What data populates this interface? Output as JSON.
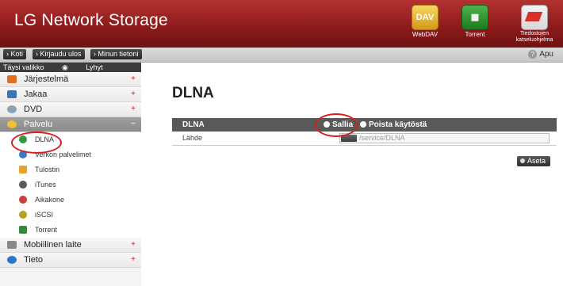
{
  "header": {
    "brand": "LG Network Storage",
    "icons": [
      {
        "name": "webdav-icon",
        "label": "WebDAV"
      },
      {
        "name": "torrent-icon",
        "label": "Torrent"
      },
      {
        "name": "manual-icon",
        "label": "Tiedostojen katseluohjelma"
      }
    ]
  },
  "toolbar": {
    "buttons": [
      "Koti",
      "Kirjaudu ulos",
      "Minun tietoni"
    ],
    "help": "Apu"
  },
  "sidebar": {
    "modes": [
      "Täysi valikko",
      "Lyhyt valikko"
    ],
    "categories": [
      {
        "label": "Järjestelmä",
        "icon": "system-icon",
        "color": "#e07020"
      },
      {
        "label": "Jakaa",
        "icon": "share-icon",
        "color": "#3f73b8"
      },
      {
        "label": "DVD",
        "icon": "dvd-icon",
        "color": "#8aa2b8"
      },
      {
        "label": "Palvelu",
        "icon": "service-icon",
        "color": "#f0c030",
        "active": true
      },
      {
        "label": "Mobiilinen laite",
        "icon": "mobile-icon",
        "color": "#8a8a8a"
      },
      {
        "label": "Tieto",
        "icon": "info-icon",
        "color": "#2a78c8"
      }
    ],
    "service_items": [
      {
        "label": "DLNA",
        "icon": "dlna-icon",
        "color": "#2f9a3a"
      },
      {
        "label": "Verkon palvelimet",
        "icon": "network-icon",
        "color": "#3a7ac8"
      },
      {
        "label": "Tulostin",
        "icon": "printer-icon",
        "color": "#e8a22a"
      },
      {
        "label": "iTunes",
        "icon": "itunes-icon",
        "color": "#5a5a5a"
      },
      {
        "label": "Aikakone",
        "icon": "timemachine-icon",
        "color": "#c84040"
      },
      {
        "label": "iSCSI",
        "icon": "iscsi-icon",
        "color": "#b8a020"
      },
      {
        "label": "Torrent",
        "icon": "torrent-small-icon",
        "color": "#2f8a3a"
      }
    ]
  },
  "main": {
    "title": "DLNA",
    "header_label": "DLNA",
    "option_on": "Sallia",
    "option_off": "Poista käytöstä",
    "row_label": "Lähde",
    "path_value": "/service/DLNA",
    "apply": "Aseta"
  },
  "colors": {
    "header": "#8e1b1c",
    "annotation": "#d3201f"
  }
}
